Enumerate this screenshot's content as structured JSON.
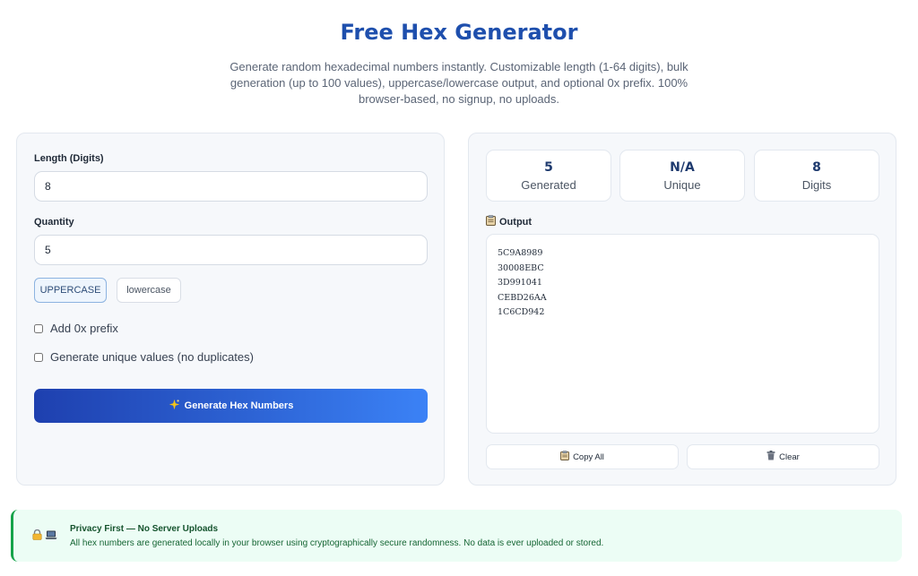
{
  "header": {
    "title": "Free Hex Generator",
    "subtitle": "Generate random hexadecimal numbers instantly. Customizable length (1-64 digits), bulk generation (up to 100 values), uppercase/lowercase output, and optional 0x prefix. 100% browser-based, no signup, no uploads."
  },
  "form": {
    "length_label": "Length (Digits)",
    "length_value": "8",
    "quantity_label": "Quantity",
    "quantity_value": "5",
    "case_options": [
      "UPPERCASE",
      "lowercase"
    ],
    "case_selected": "UPPERCASE",
    "prefix_label": "Add 0x prefix",
    "prefix_checked": false,
    "unique_label": "Generate unique values (no duplicates)",
    "unique_checked": false,
    "generate_icon": "sparkle-icon",
    "generate_label": "Generate Hex Numbers"
  },
  "stats": [
    {
      "value": "5",
      "label": "Generated"
    },
    {
      "value": "N/A",
      "label": "Unique"
    },
    {
      "value": "8",
      "label": "Digits"
    }
  ],
  "output": {
    "label": "Output",
    "icon": "clipboard-icon",
    "lines": [
      "5C9A8989",
      "30008EBC",
      "3D991041",
      "CEBD26AA",
      "1C6CD942"
    ],
    "copy_label": "Copy All",
    "clear_label": "Clear",
    "clear_icon": "trash-icon"
  },
  "privacy": {
    "icons": [
      "lock-icon",
      "laptop-icon"
    ],
    "title": "Privacy First — No Server Uploads",
    "text": "All hex numbers are generated locally in your browser using cryptographically secure randomness. No data is ever uploaded or stored."
  },
  "colors": {
    "title": "#1e4fad",
    "button_gradient_start": "#1e40af",
    "button_gradient_end": "#3b82f6",
    "privacy_bg": "#ecfdf5",
    "privacy_accent": "#16a34a"
  }
}
